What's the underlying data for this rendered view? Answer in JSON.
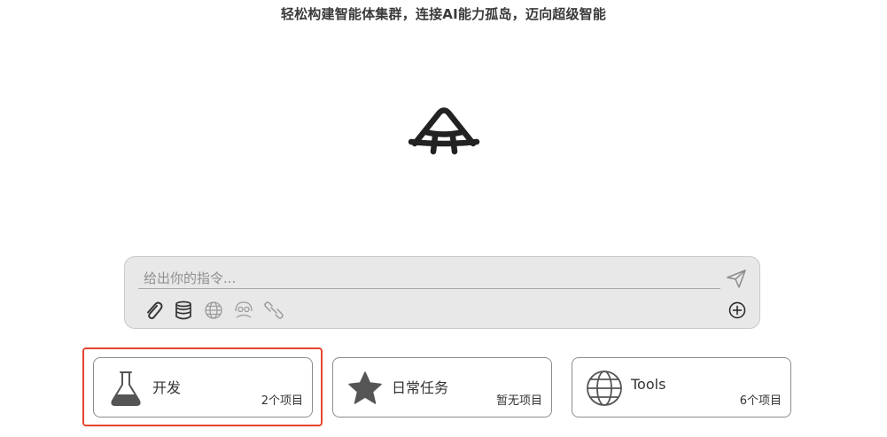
{
  "header": {
    "tagline": "轻松构建智能体集群，连接AI能力孤岛，迈向超级智能"
  },
  "logo": {
    "icon": "ai-logo-icon"
  },
  "composer": {
    "placeholder": "给出你的指令...",
    "value": "",
    "tools": [
      {
        "name": "attach-button",
        "icon": "paperclip-icon"
      },
      {
        "name": "database-button",
        "icon": "database-stack-icon"
      },
      {
        "name": "web-search-button",
        "icon": "globe-icon"
      },
      {
        "name": "agent-button",
        "icon": "agent-face-icon"
      },
      {
        "name": "link-tool-button",
        "icon": "chain-link-icon"
      }
    ],
    "send_icon": "send-arrow-icon",
    "add_icon": "plus-circle-icon"
  },
  "cards": [
    {
      "title": "开发",
      "count": "2个项目",
      "icon": "flask-icon",
      "selected": true
    },
    {
      "title": "日常任务",
      "count": "暂无项目",
      "icon": "star-icon",
      "selected": false
    },
    {
      "title": "Tools",
      "count": "6个项目",
      "icon": "globe-icon",
      "selected": false
    }
  ],
  "colors": {
    "selection_border": "#e4452d",
    "composer_bg": "#e8e8e8",
    "text": "#333333"
  }
}
